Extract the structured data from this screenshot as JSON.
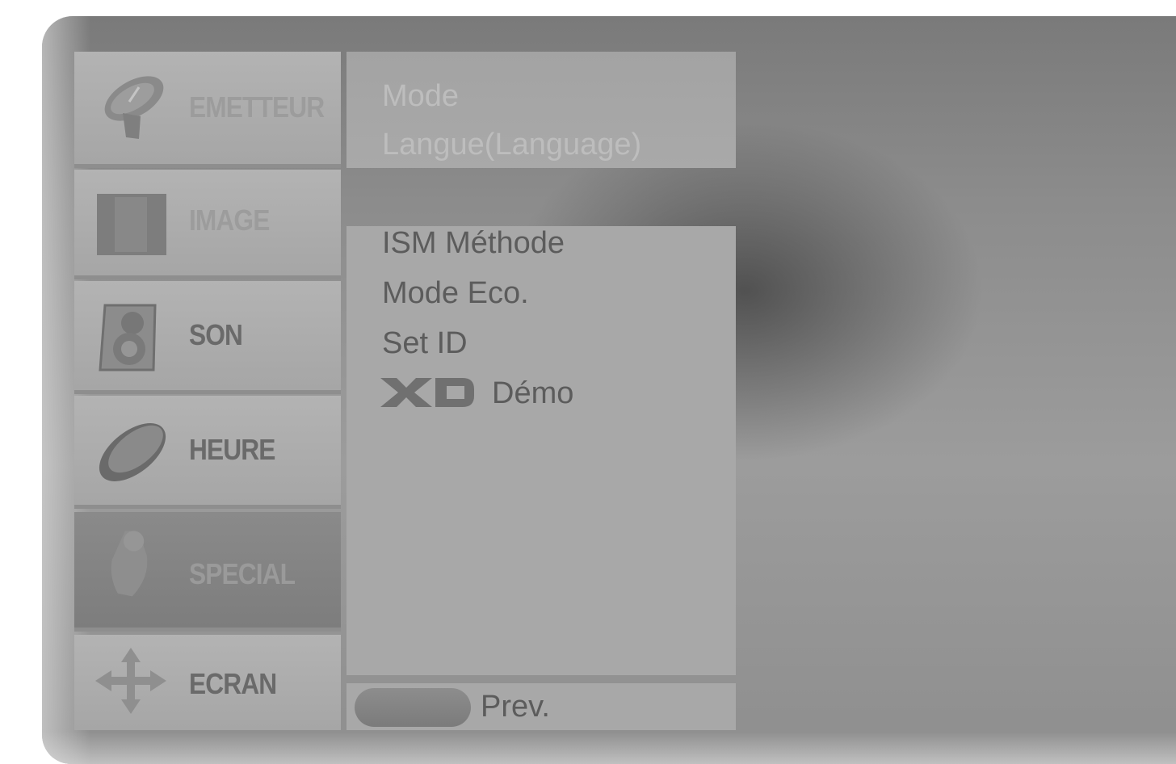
{
  "categories": [
    {
      "label": "EMETTEUR",
      "icon": "satellite-dish-icon"
    },
    {
      "label": "IMAGE",
      "icon": "picture-icon"
    },
    {
      "label": "SON",
      "icon": "speaker-icon"
    },
    {
      "label": "HEURE",
      "icon": "clock-icon"
    },
    {
      "label": "SPECIAL",
      "icon": "hand-icon"
    },
    {
      "label": "ECRAN",
      "icon": "move-arrows-icon"
    }
  ],
  "options_top": [
    "Mode",
    "Langue(Language)"
  ],
  "options": [
    "ISM Méthode",
    "Mode Eco.",
    "Set ID"
  ],
  "demo": {
    "logo": "XD",
    "label": "Démo"
  },
  "footer": {
    "prev_label": "Prev."
  }
}
